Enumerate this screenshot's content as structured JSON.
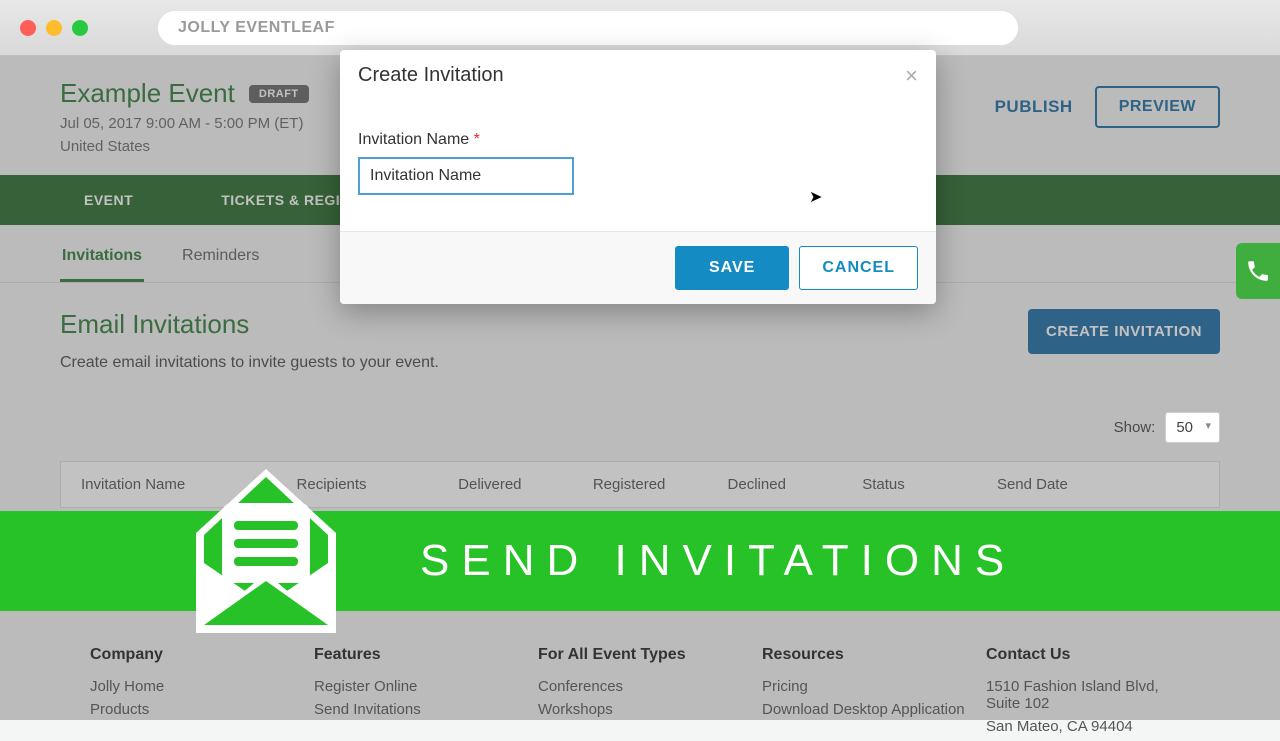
{
  "titlebar": {
    "search": "JOLLY EVENTLEAF"
  },
  "event": {
    "title": "Example Event",
    "badge": "DRAFT",
    "datetime": "Jul 05, 2017 9:00 AM - 5:00 PM (ET)",
    "location": "United States"
  },
  "header_actions": {
    "publish": "PUBLISH",
    "preview": "PREVIEW"
  },
  "nav": {
    "event": "EVENT",
    "tickets": "TICKETS & REGISTRATION"
  },
  "subtabs": {
    "invitations": "Invitations",
    "reminders": "Reminders"
  },
  "section": {
    "title": "Email Invitations",
    "desc": "Create email invitations to invite guests to your event.",
    "create_btn": "CREATE INVITATION"
  },
  "show": {
    "label": "Show:",
    "value": "50"
  },
  "table": {
    "cols": {
      "name": "Invitation Name",
      "recipients": "Recipients",
      "delivered": "Delivered",
      "registered": "Registered",
      "declined": "Declined",
      "status": "Status",
      "send_date": "Send Date"
    }
  },
  "banner": {
    "text": "SEND INVITATIONS"
  },
  "footer": {
    "company": {
      "h": "Company",
      "a": "Jolly Home",
      "b": "Products"
    },
    "features": {
      "h": "Features",
      "a": "Register Online",
      "b": "Send Invitations"
    },
    "types": {
      "h": "For All Event Types",
      "a": "Conferences",
      "b": "Workshops"
    },
    "resources": {
      "h": "Resources",
      "a": "Pricing",
      "b": "Download Desktop Application"
    },
    "contact": {
      "h": "Contact Us",
      "a": "1510 Fashion Island Blvd, Suite 102",
      "b": "San Mateo, CA 94404"
    }
  },
  "modal": {
    "title": "Create Invitation",
    "field_label": "Invitation Name",
    "required_mark": "*",
    "input_value": "Invitation Name",
    "save": "SAVE",
    "cancel": "CANCEL"
  }
}
